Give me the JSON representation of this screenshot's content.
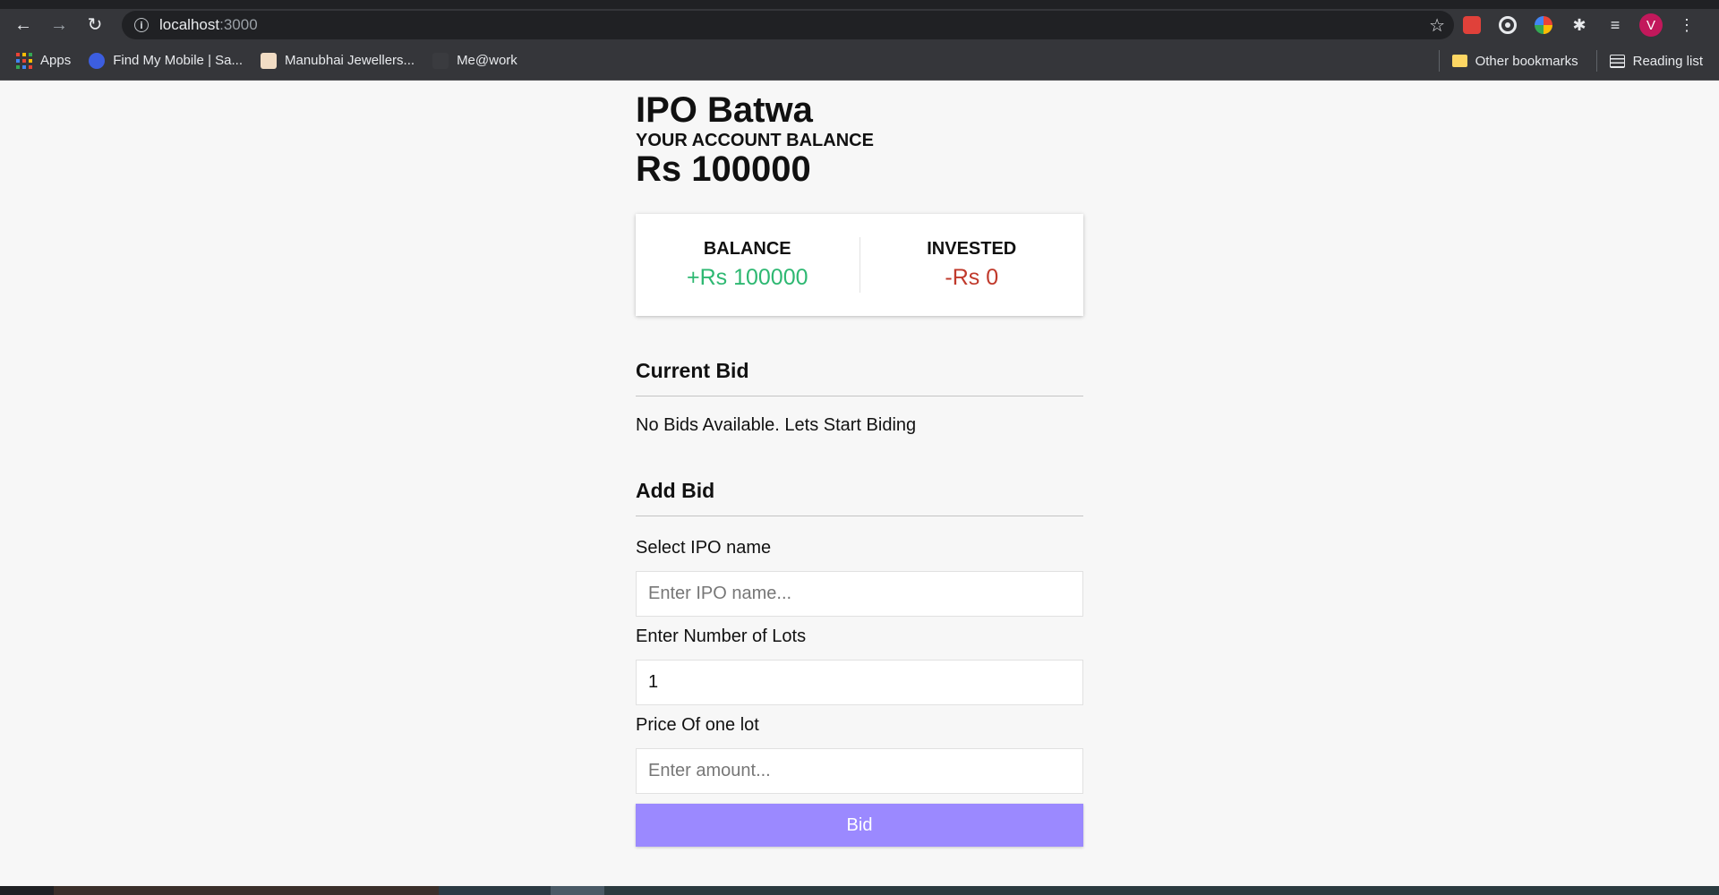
{
  "browser": {
    "url_host": "localhost",
    "url_port": ":3000",
    "icons": {
      "back": "←",
      "forward": "→",
      "reload": "↻",
      "info": "i",
      "star": "☆",
      "puzzle": "✱",
      "media": "≡",
      "menu": "⋮"
    },
    "avatar_letter": "V",
    "bookmarks": [
      {
        "label": "Apps"
      },
      {
        "label": "Find My Mobile | Sa..."
      },
      {
        "label": "Manubhai Jewellers..."
      },
      {
        "label": "Me@work"
      }
    ],
    "other_bookmarks": "Other bookmarks",
    "reading_list": "Reading list"
  },
  "app": {
    "title": "IPO Batwa",
    "balance_caption": "YOUR ACCOUNT BALANCE",
    "balance_amount": "Rs 100000"
  },
  "summary": {
    "balance_label": "BALANCE",
    "balance_value": "+Rs 100000",
    "invested_label": "INVESTED",
    "invested_value": "-Rs 0"
  },
  "current_bid": {
    "heading": "Current Bid",
    "empty_message": "No Bids Available. Lets Start Biding"
  },
  "add_bid": {
    "heading": "Add Bid",
    "ipo_label": "Select IPO name",
    "ipo_placeholder": "Enter IPO name...",
    "lots_label": "Enter Number of Lots",
    "lots_value": "1",
    "price_label": "Price Of one lot",
    "price_placeholder": "Enter amount...",
    "submit_label": "Bid"
  },
  "colors": {
    "positive": "#2eb872",
    "negative": "#c0392b",
    "button": "#9b89ff"
  }
}
